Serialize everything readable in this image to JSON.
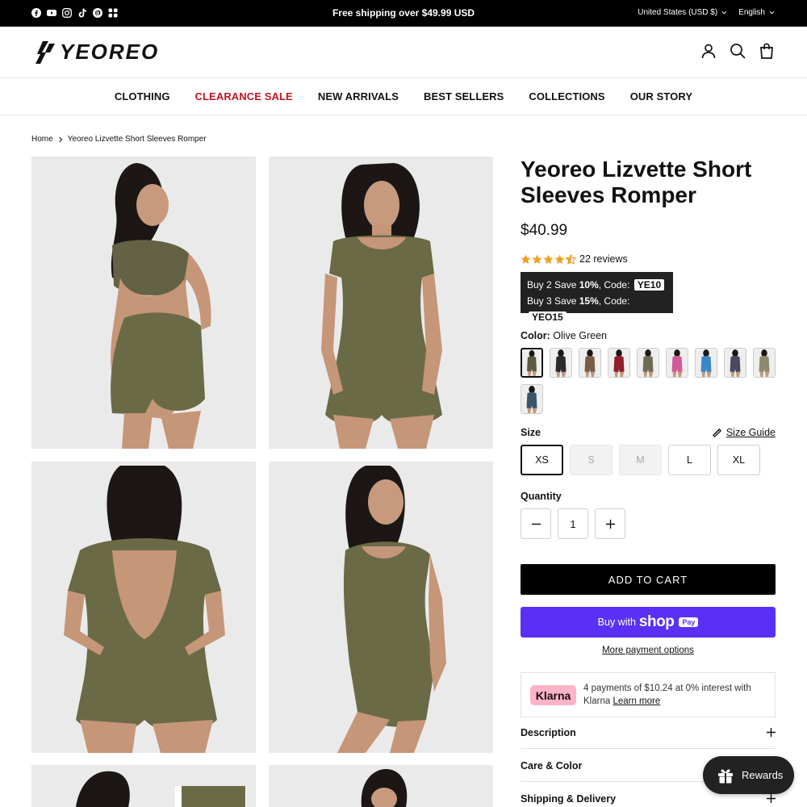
{
  "announcement": {
    "text": "Free shipping over $49.99 USD",
    "country": "United States (USD $)",
    "language": "English",
    "social_icons": [
      "facebook-icon",
      "youtube-icon",
      "instagram-icon",
      "tiktok-icon",
      "pinterest-icon",
      "app-icon"
    ]
  },
  "header": {
    "logo_text": "YEOREO"
  },
  "nav": {
    "items": [
      "CLOTHING",
      "CLEARANCE SALE",
      "NEW ARRIVALS",
      "BEST SELLERS",
      "COLLECTIONS",
      "OUR STORY"
    ]
  },
  "breadcrumb": {
    "home": "Home",
    "current": "Yeoreo Lizvette Short Sleeves Romper"
  },
  "product": {
    "title": "Yeoreo Lizvette Short Sleeves Romper",
    "price": "$40.99",
    "rating": 4.5,
    "reviews": "22 reviews",
    "promo": {
      "line1_prefix": "Buy 2 Save ",
      "line1_pct": "10%",
      "line1_mid": ", Code: ",
      "line1_code": "YE10",
      "line2_prefix": "Buy 3 Save ",
      "line2_pct": "15%",
      "line2_mid": ", Code: ",
      "line2_code": "YEO15"
    },
    "color_label": "Color:",
    "color_value": "Olive Green",
    "swatch_colors": [
      "#5b5a3e",
      "#2a2a2a",
      "#7a5a4a",
      "#8e1f2c",
      "#6d6a55",
      "#d25a99",
      "#3a86c6",
      "#4a4a5e",
      "#8f8a6d",
      "#3a5566"
    ],
    "size_label": "Size",
    "size_guide": "Size Guide",
    "sizes": [
      "XS",
      "S",
      "M",
      "L",
      "XL"
    ],
    "quantity_label": "Quantity",
    "quantity": "1",
    "add_to_cart": "ADD TO CART",
    "buy_with": "Buy with",
    "shop_brand": "shop",
    "shop_pay": "Pay",
    "more_payment": "More payment options",
    "klarna_logo": "Klarna",
    "klarna_text": "4 payments of $10.24 at 0% interest with Klarna",
    "klarna_link": "Learn more",
    "accordions": [
      "Description",
      "Care & Color",
      "Shipping & Delivery"
    ]
  },
  "rewards": {
    "label": "Rewards"
  },
  "colors": {
    "olive": "#6b6a46",
    "sale_red": "#c0151f",
    "shop_pay": "#5a31f4",
    "star": "#f0a020"
  }
}
